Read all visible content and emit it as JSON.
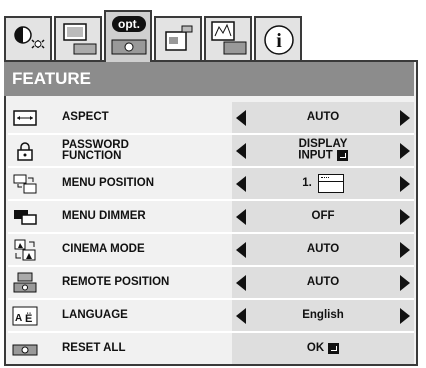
{
  "tabs": [
    {
      "name": "image-adjust-tab",
      "icon": "contrast-sun-icon"
    },
    {
      "name": "picture-tab",
      "icon": "picture-monitor-icon"
    },
    {
      "name": "option-tab",
      "icon": "opt-projector-icon",
      "label": "opt."
    },
    {
      "name": "installation-tab",
      "icon": "install-icon"
    },
    {
      "name": "signal-tab",
      "icon": "signal-screen-icon"
    },
    {
      "name": "info-tab",
      "icon": "info-icon",
      "label": "i"
    }
  ],
  "menu": {
    "title": "FEATURE",
    "rows": [
      {
        "label": "ASPECT",
        "value": "AUTO",
        "icon": "aspect-icon"
      },
      {
        "label": "PASSWORD FUNCTION",
        "label_line1": "PASSWORD",
        "label_line2": "FUNCTION",
        "value_line1": "DISPLAY",
        "value_line2": "INPUT",
        "icon": "padlock-icon"
      },
      {
        "label": "MENU POSITION",
        "value": "1.",
        "icon": "menu-position-icon"
      },
      {
        "label": "MENU DIMMER",
        "value": "OFF",
        "icon": "menu-dimmer-icon"
      },
      {
        "label": "CINEMA MODE",
        "value": "AUTO",
        "icon": "cinema-mode-icon"
      },
      {
        "label": "REMOTE POSITION",
        "value": "AUTO",
        "icon": "remote-position-icon"
      },
      {
        "label": "LANGUAGE",
        "value": "English",
        "icon": "language-icon"
      },
      {
        "label": "RESET ALL",
        "value": "OK",
        "icon": "reset-all-icon"
      }
    ]
  },
  "colors": {
    "title_bg": "#8c8c8c",
    "row_bg": "#f1f1f1",
    "value_bg": "#dedede",
    "border": "#3a3a3a"
  }
}
